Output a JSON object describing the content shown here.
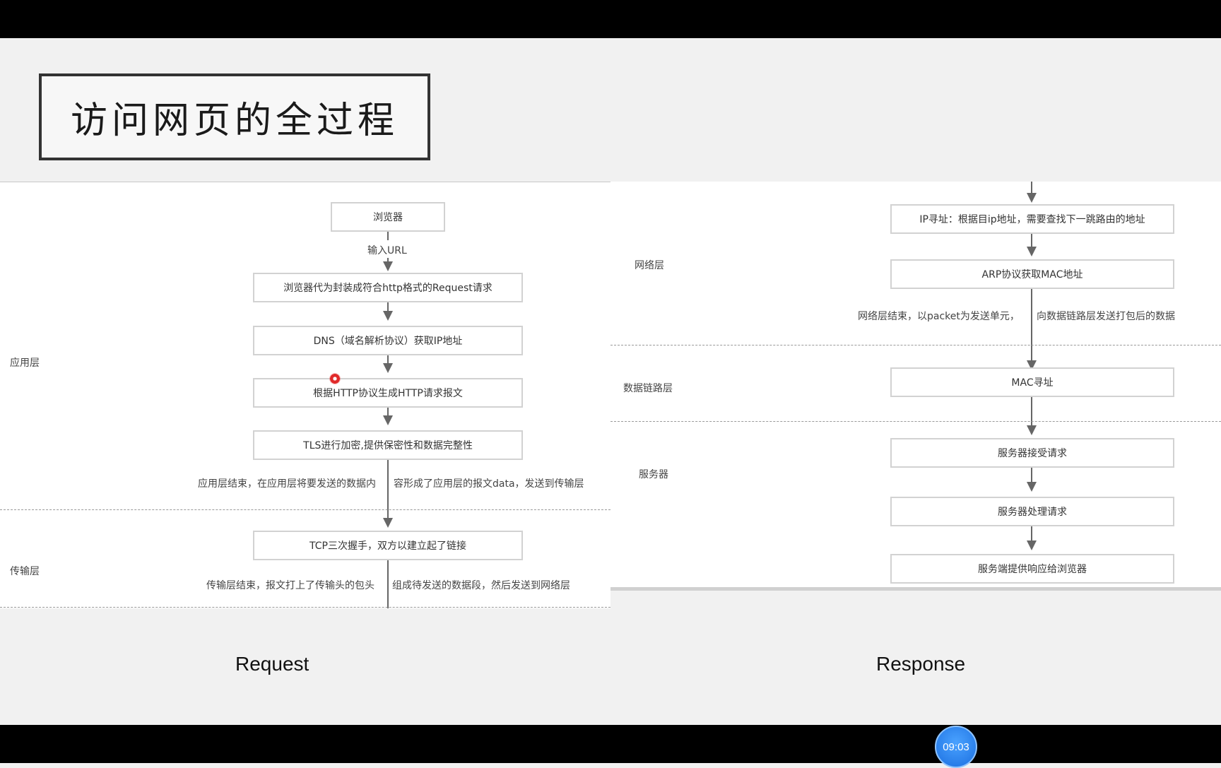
{
  "title": "访问网页的全过程",
  "request": {
    "caption": "Request",
    "input_url": "输入URL",
    "boxes": [
      "浏览器",
      "浏览器代为封装成符合http格式的Request请求",
      "DNS（域名解析协议）获取IP地址",
      "根据HTTP协议生成HTTP请求报文",
      "TLS进行加密,提供保密性和数据完整性",
      "TCP三次握手，双方以建立起了链接"
    ],
    "notes": {
      "app_end_left": "应用层结束，在应用层将要发送的数据内",
      "app_end_right": "容形成了应用层的报文data，发送到传输层",
      "transport_end_left": "传输层结束，报文打上了传输头的包头",
      "transport_end_right": "组成待发送的数据段，然后发送到网络层"
    },
    "layers": {
      "application": "应用层",
      "transport": "传输层"
    }
  },
  "response": {
    "caption": "Response",
    "boxes": [
      "IP寻址：根据目ip地址，需要查找下一跳路由的地址",
      "ARP协议获取MAC地址",
      "MAC寻址",
      "服务器接受请求",
      "服务器处理请求",
      "服务端提供响应给浏览器"
    ],
    "notes": {
      "network_end_left": "网络层结束，以packet为发送单元，",
      "network_end_right": "向数据链路层发送打包后的数据"
    },
    "layers": {
      "network": "网络层",
      "datalink": "数据链路层",
      "server": "服务器"
    }
  },
  "timer": "09:03"
}
